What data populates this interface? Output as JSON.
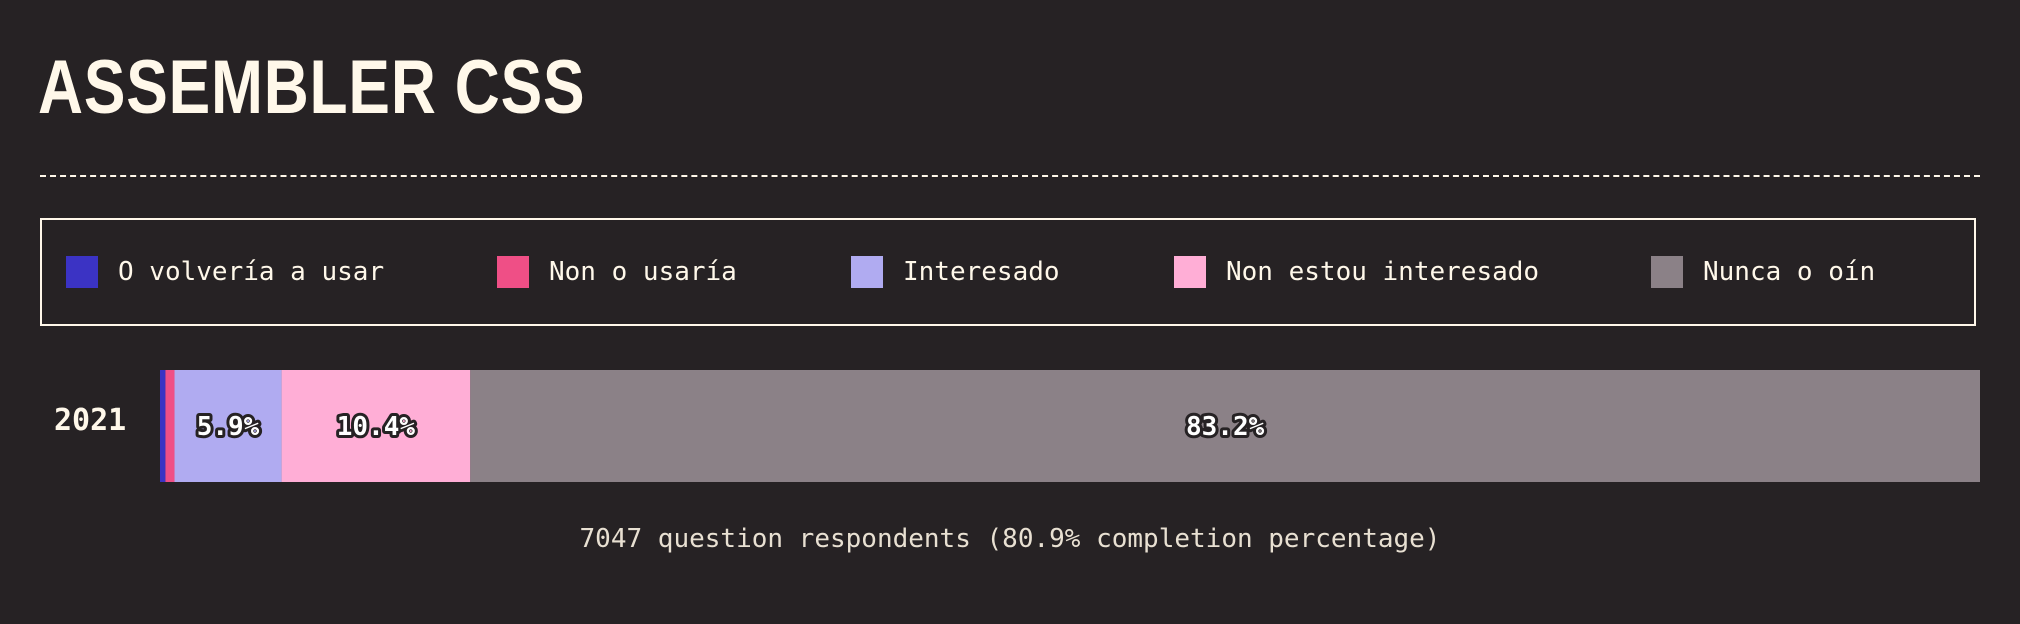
{
  "title": "ASSEMBLER CSS",
  "footer": "7047 question respondents (80.9% completion percentage)",
  "chart_data": {
    "type": "bar",
    "orientation": "horizontal",
    "stacked": true,
    "categories": [
      "2021"
    ],
    "xlim": [
      0,
      100
    ],
    "grid": false,
    "legend_position": "top",
    "series": [
      {
        "name": "O volvería a usar",
        "color": "#3b33c4",
        "values": [
          0.3
        ],
        "label": ""
      },
      {
        "name": "Non o usaría",
        "color": "#ef4f86",
        "values": [
          0.5
        ],
        "label": ""
      },
      {
        "name": "Interesado",
        "color": "#b0abf1",
        "values": [
          5.9
        ],
        "label": "5.9%"
      },
      {
        "name": "Non estou interesado",
        "color": "#ffaed6",
        "values": [
          10.4
        ],
        "label": "10.4%"
      },
      {
        "name": "Nunca o oín",
        "color": "#8b8187",
        "values": [
          83.2
        ],
        "label": "83.2%"
      }
    ]
  }
}
